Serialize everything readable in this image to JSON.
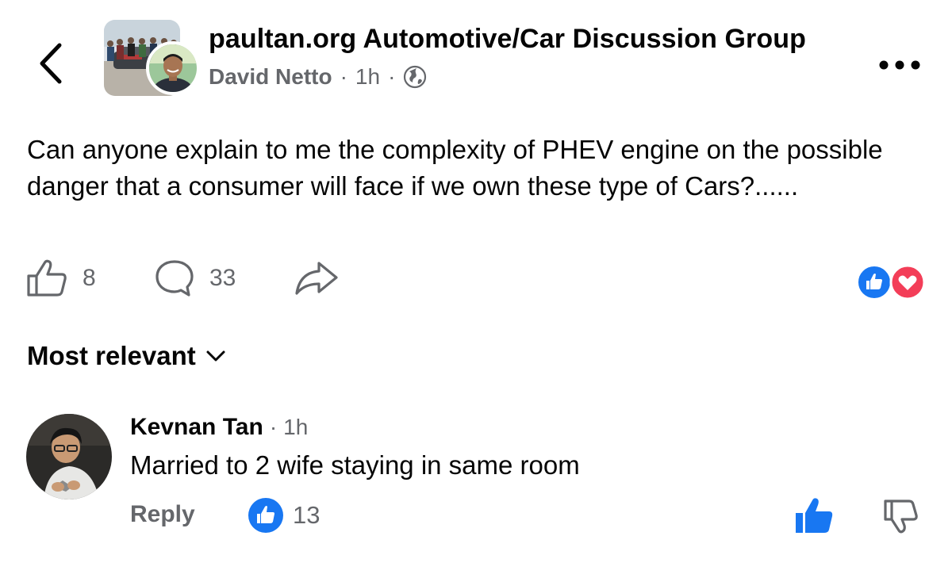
{
  "header": {
    "group_name": "paultan.org Automotive/Car Discussion Group",
    "author": "David Netto",
    "separator": "·",
    "time": "1h",
    "privacy_icon": "globe-icon",
    "back_icon": "chevron-left-icon",
    "more_icon": "more-horizontal-icon"
  },
  "post": {
    "text": "Can anyone explain to me the complexity of PHEV engine on the possible danger that a consumer will face if we own these type of Cars?......",
    "like_count": "8",
    "comment_count": "33",
    "reactions": [
      "like",
      "love"
    ]
  },
  "sort": {
    "label": "Most relevant"
  },
  "comments": [
    {
      "author": "Kevnan Tan",
      "separator": "·",
      "time": "1h",
      "text": "Married to 2 wife staying in same room",
      "reply_label": "Reply",
      "like_count": "13"
    }
  ],
  "colors": {
    "facebook_blue": "#1877f2",
    "love_red": "#f33e58",
    "secondary_text": "#65676b",
    "primary_text": "#050505"
  }
}
